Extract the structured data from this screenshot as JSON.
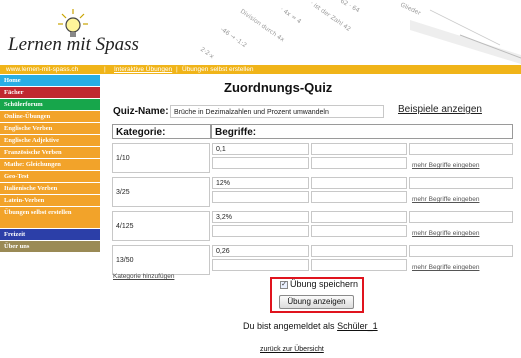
{
  "header": {
    "logo_text": "Lernen mit Spass"
  },
  "topbar": {
    "site": "www.lernen-mit-spass.ch",
    "sep": "|",
    "link1": "Interaktive Übungen",
    "link2": "Übungen selbst erstellen"
  },
  "sidebar": {
    "items": [
      {
        "label": "Home",
        "color": "#29aee5"
      },
      {
        "label": "Fächer",
        "color": "#c0282f"
      },
      {
        "label": "Schülerforum",
        "color": "#17a64b"
      },
      {
        "label": "Online-Übungen",
        "color": "#f2a32a"
      },
      {
        "label": "Englische Verben",
        "color": "#f2a32a"
      },
      {
        "label": "Englische Adjektive",
        "color": "#f2a32a"
      },
      {
        "label": "Französische Verben",
        "color": "#f2a32a"
      },
      {
        "label": "Mathe: Gleichungen",
        "color": "#f2a32a"
      },
      {
        "label": "Geo-Test",
        "color": "#f2a32a"
      },
      {
        "label": "Italienische Verben",
        "color": "#f2a32a"
      },
      {
        "label": "Latein-Verben",
        "color": "#f2a32a"
      },
      {
        "label": "Übungen selbst erstellen",
        "color": "#f2a32a"
      },
      {
        "label": "Freizeit",
        "color": "#2c3fa8"
      },
      {
        "label": "Über uns",
        "color": "#9a8a55"
      }
    ]
  },
  "main": {
    "title": "Zuordnungs-Quiz",
    "quiz_name_label": "Quiz-Name:",
    "quiz_name_value": "Brüche in Dezimalzahlen und Prozent umwandeln",
    "examples_link": "Beispiele anzeigen",
    "col_kategorie": "Kategorie:",
    "col_begriffe": "Begriffe:",
    "rows": [
      {
        "kategorie": "1/10",
        "begriff": "0,1",
        "more": "mehr Begriffe eingeben"
      },
      {
        "kategorie": "3/25",
        "begriff": "12%",
        "more": "mehr Begriffe eingeben"
      },
      {
        "kategorie": "4/125",
        "begriff": "3,2%",
        "more": "mehr Begriffe eingeben"
      },
      {
        "kategorie": "13/50",
        "begriff": "0,26",
        "more": "mehr Begriffe eingeben"
      }
    ],
    "add_category": "Kategorie hinzufügen",
    "save_checkbox_label": "Übung speichern",
    "save_checked": true,
    "show_button": "Übung anzeigen",
    "login_prefix": "Du bist angemeldet als",
    "login_user": "Schüler_1",
    "back_link": "zurück zur Übersicht"
  },
  "colors": {
    "topbar": "#f0b419",
    "highlight_box": "#e0141e"
  }
}
